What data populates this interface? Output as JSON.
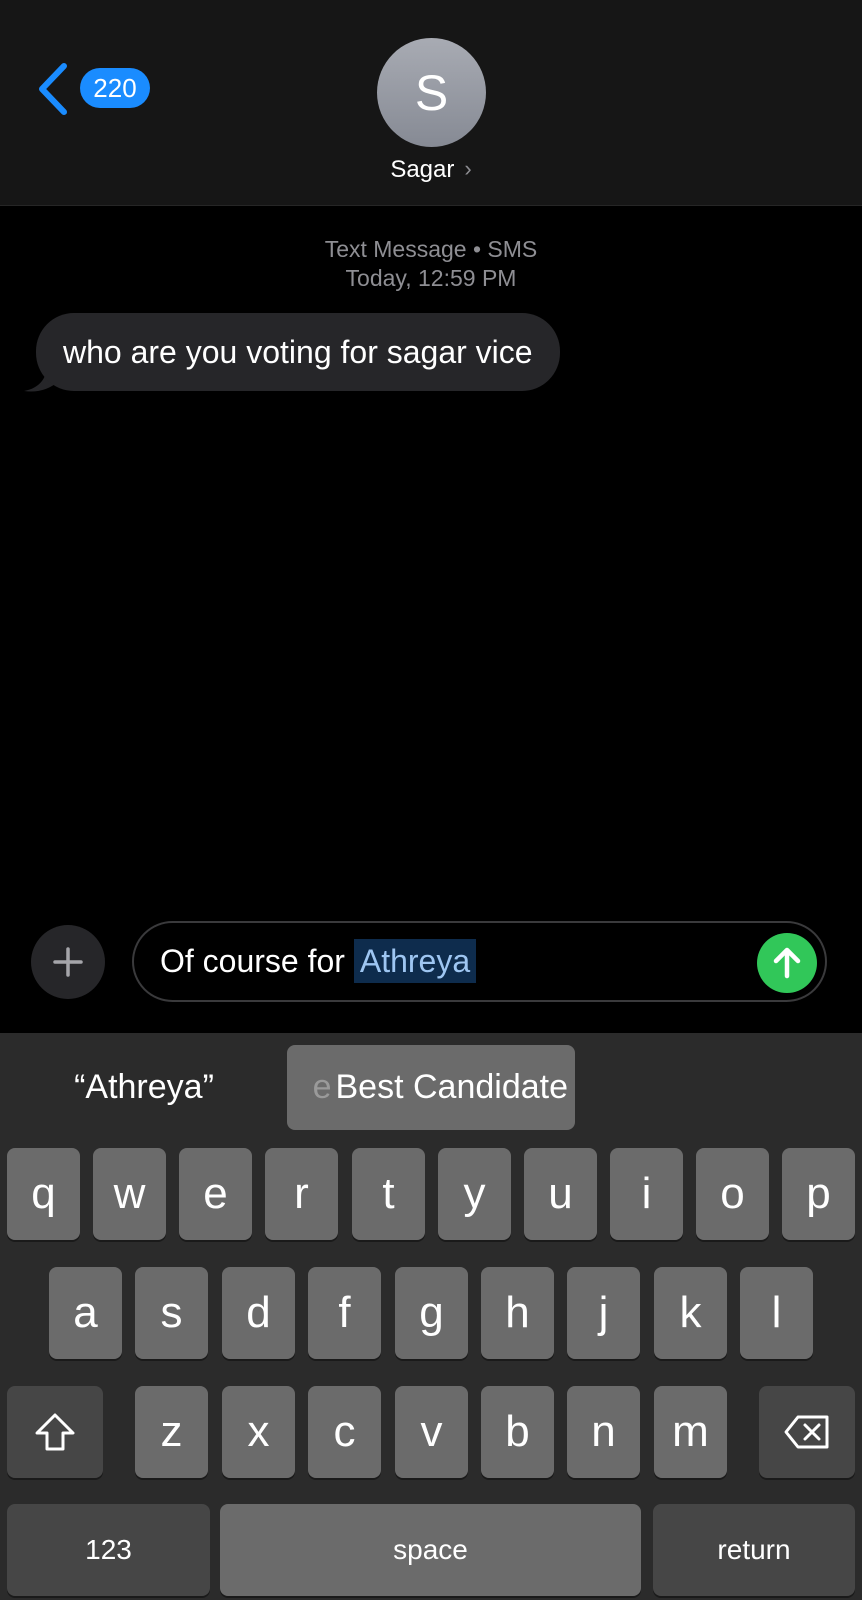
{
  "header": {
    "back_count": "220",
    "avatar_initial": "S",
    "contact_name": "Sagar"
  },
  "conversation": {
    "service": "Text Message • SMS",
    "timestamp": "Today, 12:59 PM",
    "messages": [
      {
        "direction": "incoming",
        "text": "who are you voting for sagar vice"
      }
    ]
  },
  "composer": {
    "text_before": "Of course for ",
    "selected_text": "Athreya"
  },
  "keyboard": {
    "suggestions": [
      "“Athreya”",
      "e",
      "Best Candidate"
    ],
    "row1": [
      "q",
      "w",
      "e",
      "r",
      "t",
      "y",
      "u",
      "i",
      "o",
      "p"
    ],
    "row2": [
      "a",
      "s",
      "d",
      "f",
      "g",
      "h",
      "j",
      "k",
      "l"
    ],
    "row3": [
      "z",
      "x",
      "c",
      "v",
      "b",
      "n",
      "m"
    ],
    "numbers_label": "123",
    "space_label": "space",
    "return_label": "return"
  },
  "colors": {
    "accent_blue": "#1a8cff",
    "send_green": "#31c759",
    "bubble_gray": "#262629",
    "key_gray": "#6b6b6b"
  }
}
